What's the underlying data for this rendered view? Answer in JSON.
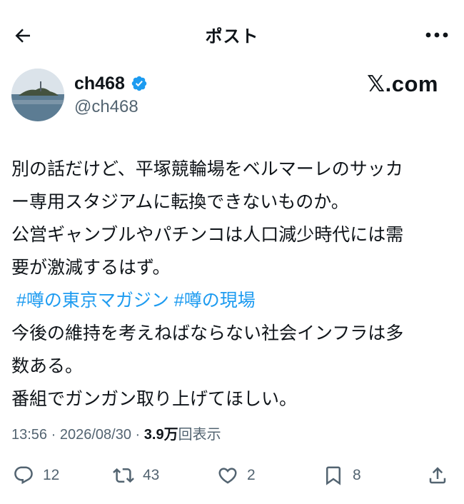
{
  "header": {
    "title": "ポスト",
    "back_icon": "arrow-left-icon",
    "more_icon": "more-horizontal-icon"
  },
  "author": {
    "display_name": "ch468",
    "handle": "@ch468",
    "verified_icon": "verified-badge-icon",
    "verified_color": "#1d9bf0"
  },
  "brand": {
    "label": "𝕏.com"
  },
  "post": {
    "line1": "別の話だけど、平塚競輪場をベルマーレのサッカ",
    "line2": "ー専用スタジアムに転換できないものか。",
    "line3": "公営ギャンブルやパチンコは人口減少時代には需",
    "line4": "要が激減するはず。",
    "hashtag1": "#噂の東京マガジン",
    "hashtag2": "#噂の現場",
    "line6": "今後の維持を考えねばならない社会インフラは多",
    "line7": "数ある。",
    "line8": "番組でガンガン取り上げてほしい。"
  },
  "meta": {
    "time": "13:56",
    "separator": "·",
    "date": "2026/08/30",
    "views_count": "3.9万",
    "views_label": "回表示"
  },
  "actions": {
    "reply_count": "12",
    "repost_count": "43",
    "like_count": "2",
    "bookmark_count": "8"
  },
  "colors": {
    "text": "#0f1419",
    "secondary": "#536471",
    "link": "#1d9bf0"
  }
}
